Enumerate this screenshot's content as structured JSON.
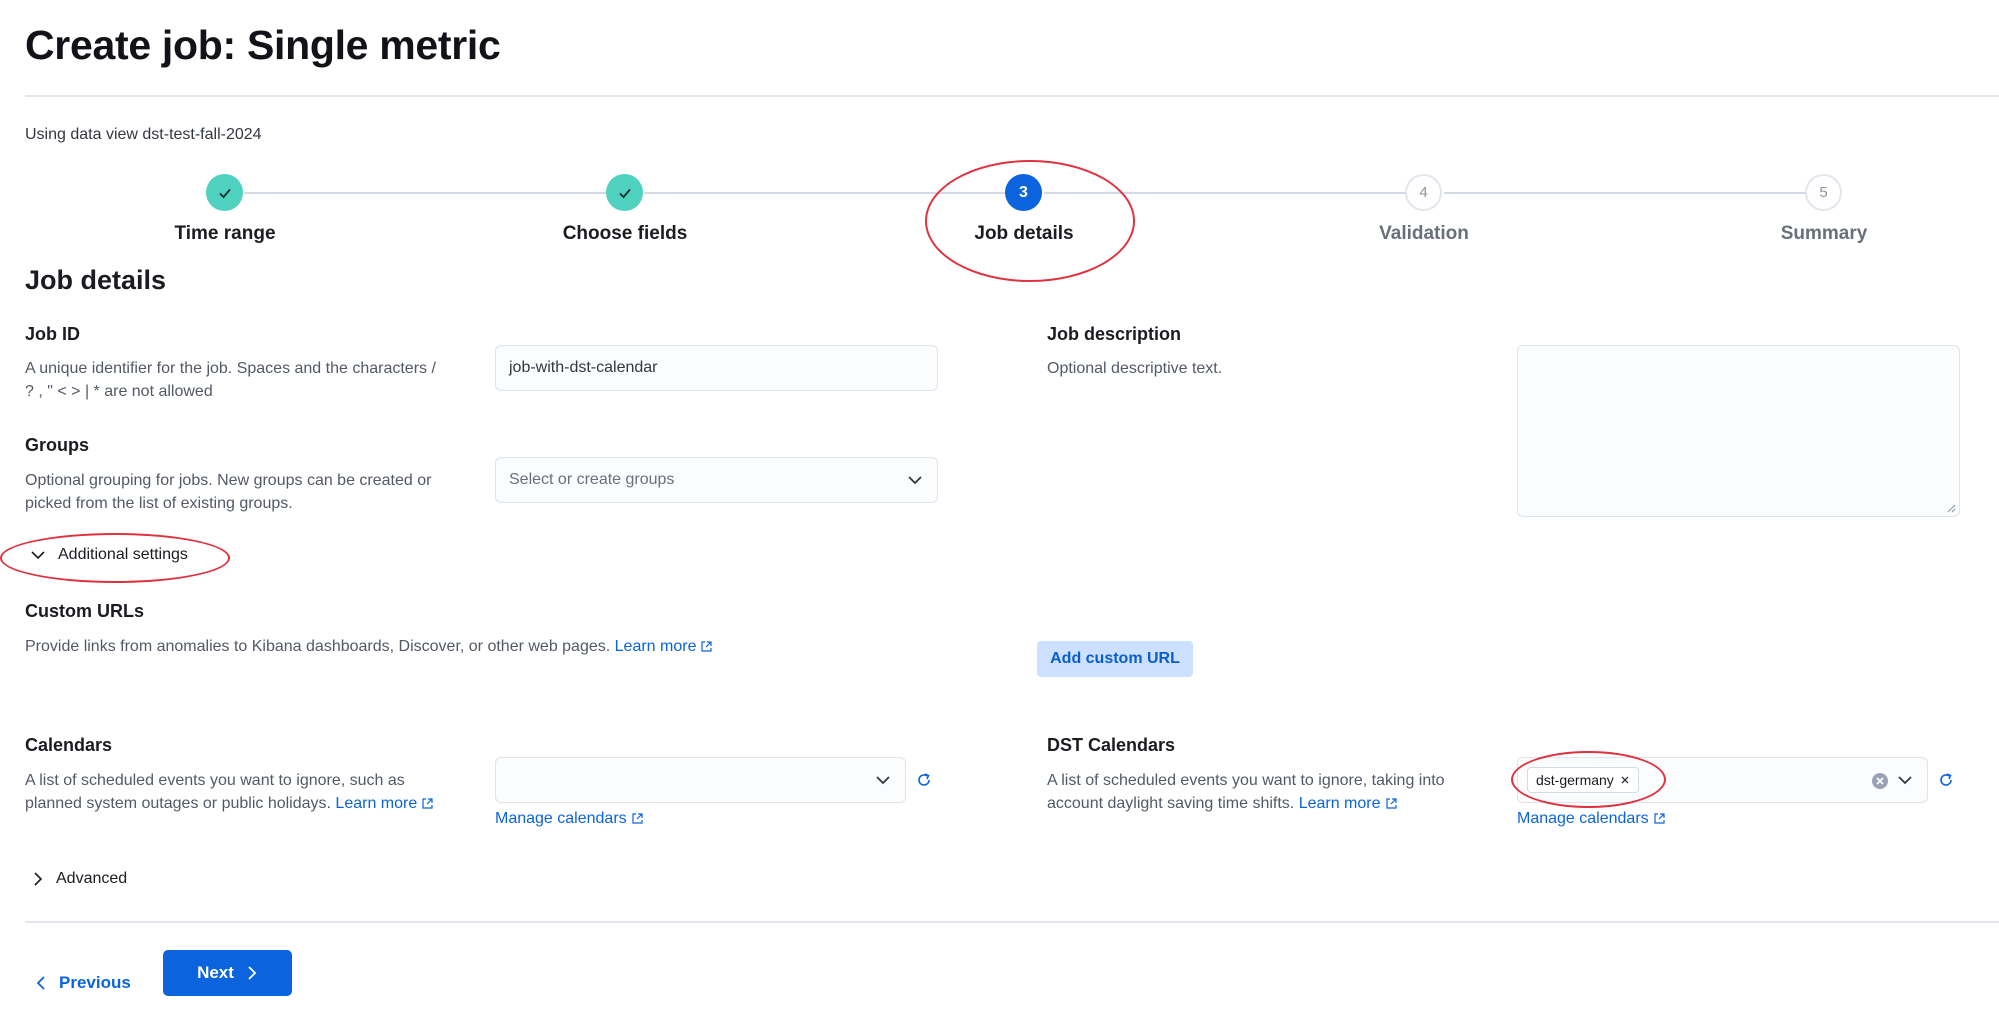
{
  "page": {
    "title": "Create job: Single metric",
    "data_view_text": "Using data view dst-test-fall-2024"
  },
  "stepper": {
    "steps": [
      {
        "number": "1",
        "label": "Time range",
        "status": "complete"
      },
      {
        "number": "2",
        "label": "Choose fields",
        "status": "complete"
      },
      {
        "number": "3",
        "label": "Job details",
        "status": "current"
      },
      {
        "number": "4",
        "label": "Validation",
        "status": "incomplete"
      },
      {
        "number": "5",
        "label": "Summary",
        "status": "incomplete"
      }
    ]
  },
  "job_details": {
    "section_title": "Job details",
    "job_id": {
      "title": "Job ID",
      "help_line1": "A unique identifier for the job. Spaces and the characters /",
      "help_line2": "? , \" < > | * are not allowed",
      "value": "job-with-dst-calendar"
    },
    "job_description": {
      "title": "Job description",
      "help": "Optional descriptive text.",
      "value": ""
    },
    "groups": {
      "title": "Groups",
      "help_line1": "Optional grouping for jobs. New groups can be created or",
      "help_line2": "picked from the list of existing groups.",
      "placeholder": "Select or create groups"
    }
  },
  "additional_settings": {
    "label": "Additional settings",
    "expanded": true,
    "custom_urls": {
      "title": "Custom URLs",
      "help": "Provide links from anomalies to Kibana dashboards, Discover, or other web pages.",
      "learn_more": "Learn more",
      "add_button": "Add custom URL"
    },
    "calendars": {
      "title": "Calendars",
      "help_line1": "A list of scheduled events you want to ignore, such as",
      "help_line2": "planned system outages or public holidays.",
      "learn_more": "Learn more",
      "manage": "Manage calendars"
    },
    "dst_calendars": {
      "title": "DST Calendars",
      "help_line1": "A list of scheduled events you want to ignore, taking into",
      "help_line2": "account daylight saving time shifts.",
      "learn_more": "Learn more",
      "manage": "Manage calendars",
      "selected": [
        "dst-germany"
      ]
    }
  },
  "advanced": {
    "label": "Advanced",
    "expanded": false
  },
  "footer": {
    "previous": "Previous",
    "next": "Next"
  },
  "colors": {
    "primary": "#0b64dd",
    "step_complete": "#4fd1c0",
    "annotation": "#e0323e"
  }
}
